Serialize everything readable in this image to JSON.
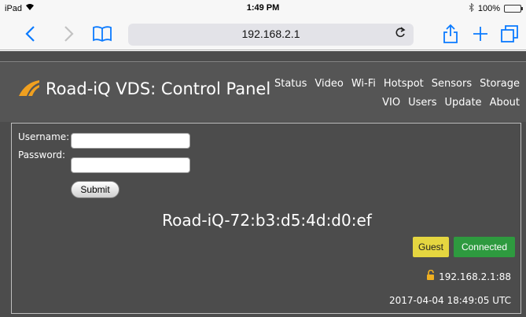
{
  "status_bar": {
    "device": "iPad",
    "time": "1:49 PM",
    "battery_percent": "100%",
    "battery_level": 1.0,
    "icons": [
      "wifi-icon",
      "bluetooth-icon",
      "battery-icon"
    ]
  },
  "browser": {
    "url": "192.168.2.1",
    "icons": [
      "back-icon",
      "forward-icon",
      "bookmarks-icon",
      "reload-icon",
      "share-icon",
      "new-tab-icon",
      "tabs-icon"
    ]
  },
  "page": {
    "title": "Road-iQ VDS: Control Panel",
    "nav_row1": [
      "Status",
      "Video",
      "Wi-Fi",
      "Hotspot",
      "Sensors",
      "Storage"
    ],
    "nav_row2": [
      "VIO",
      "Users",
      "Update",
      "About"
    ],
    "login": {
      "username_label": "Username:",
      "password_label": "Password:",
      "username_value": "",
      "password_value": "",
      "submit_label": "Submit"
    },
    "device_id": "Road-iQ-72:b3:d5:4d:d0:ef",
    "badges": {
      "guest": "Guest",
      "connected": "Connected"
    },
    "ip_address": "192.168.2.1:88",
    "timestamp": "2017-04-04 18:49:05 UTC"
  },
  "colors": {
    "page_bg": "#4c4c4c",
    "header_bg": "#555555",
    "logo_orange": "#f0a020",
    "guest_badge": "#e5d640",
    "connected_badge": "#2e9a3f",
    "ios_blue": "#0a7aff"
  }
}
